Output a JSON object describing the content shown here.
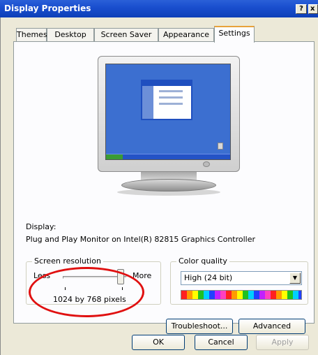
{
  "window": {
    "title": "Display Properties",
    "help_label": "?",
    "close_label": "x"
  },
  "tabs": [
    {
      "label": "Themes"
    },
    {
      "label": "Desktop"
    },
    {
      "label": "Screen Saver"
    },
    {
      "label": "Appearance"
    },
    {
      "label": "Settings",
      "active": true
    }
  ],
  "display": {
    "label": "Display:",
    "value": "Plug and Play Monitor on Intel(R) 82815 Graphics Controller"
  },
  "resolution": {
    "title": "Screen resolution",
    "less_label": "Less",
    "more_label": "More",
    "value": "1024 by 768 pixels",
    "slider_level": 0.9
  },
  "color_quality": {
    "title": "Color quality",
    "selected": "High (24 bit)"
  },
  "buttons": {
    "troubleshoot": "Troubleshoot...",
    "advanced": "Advanced",
    "ok": "OK",
    "cancel": "Cancel",
    "apply": "Apply"
  },
  "colors": {
    "title_bar": "#1a4fcf",
    "highlight_oval": "#e01010",
    "dialog_bg": "#ece9d8"
  }
}
